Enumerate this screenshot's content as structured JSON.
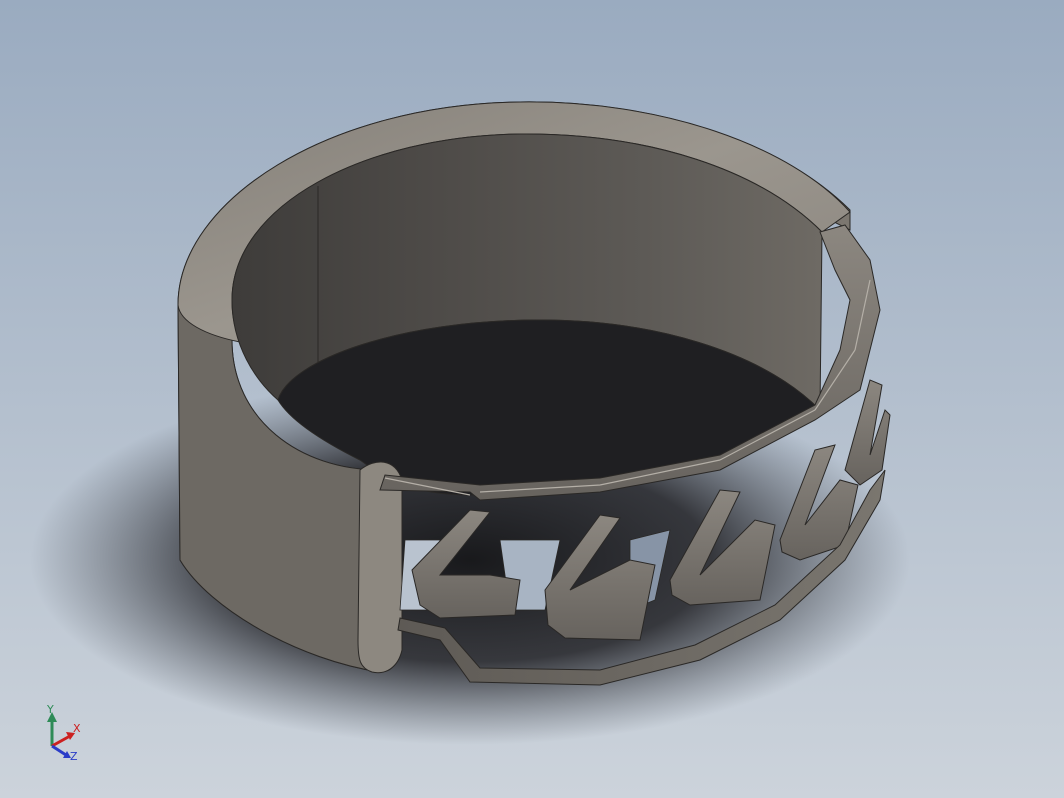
{
  "viewport": {
    "background_top": "#9fb0c4",
    "background_bottom": "#c9d1da",
    "model_body_color": "#6f6b65",
    "model_inner_color": "#4d4a47",
    "model_highlight_color": "#a29d95",
    "shadow_color": "#1b1b1d"
  },
  "triad": {
    "y_label": "Y",
    "x_label": "X",
    "z_label": "Z",
    "y_color": "#2e8b57",
    "x_color": "#cc2020",
    "z_color": "#2a3cc8"
  }
}
